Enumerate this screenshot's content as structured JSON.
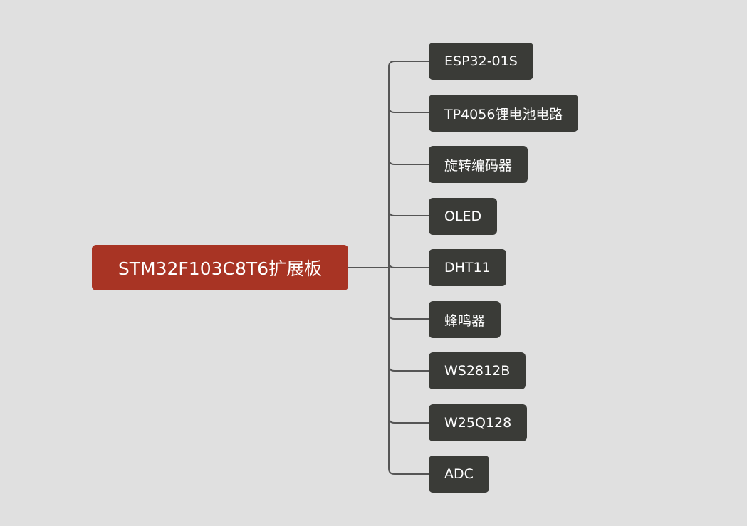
{
  "diagram": {
    "root": {
      "label": "STM32F103C8T6扩展板"
    },
    "children": [
      {
        "label": "ESP32-01S"
      },
      {
        "label": "TP4056锂电池电路"
      },
      {
        "label": "旋转编码器"
      },
      {
        "label": "OLED"
      },
      {
        "label": "DHT11"
      },
      {
        "label": "蜂鸣器"
      },
      {
        "label": "WS2812B"
      },
      {
        "label": "W25Q128"
      },
      {
        "label": "ADC"
      }
    ],
    "colors": {
      "background": "#e0e0e0",
      "root_fill": "#a83424",
      "child_fill": "#3a3b37",
      "connector": "#555555",
      "text": "#ffffff"
    }
  }
}
